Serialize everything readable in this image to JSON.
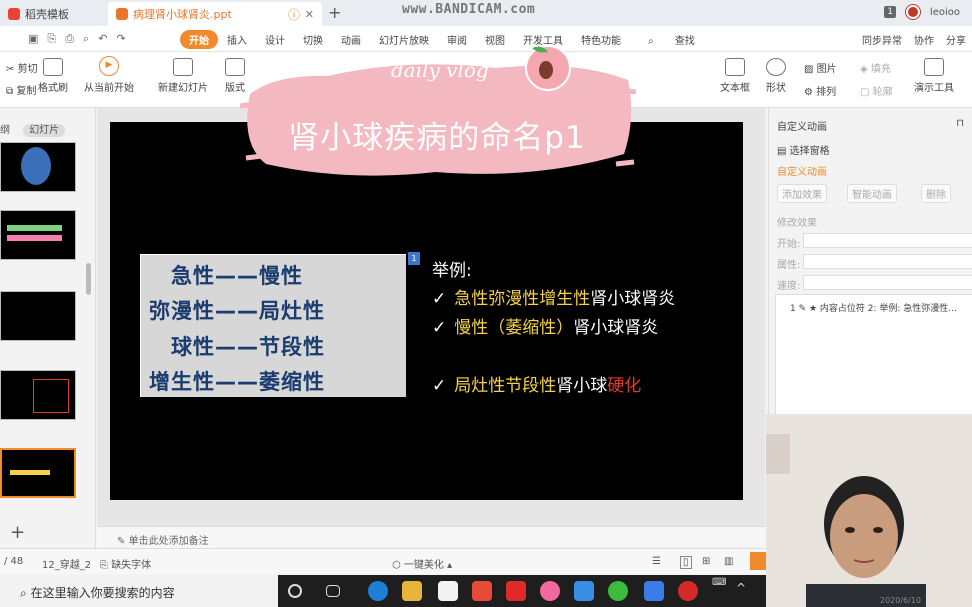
{
  "tabs": {
    "docer": "稻壳模板",
    "ppt": "病理肾小球肾炎.ppt"
  },
  "watermark": "www.BANDICAM.com",
  "user": {
    "badge": "1",
    "name": "leoioo"
  },
  "menu": {
    "items": [
      "开始",
      "插入",
      "设计",
      "切换",
      "动画",
      "幻灯片放映",
      "审阅",
      "视图",
      "开发工具",
      "特色功能"
    ],
    "search": "查找",
    "right": [
      "同步异常",
      "协作",
      "分享"
    ]
  },
  "ribbon": {
    "cut": "剪切",
    "copy": "复制",
    "format_painter": "格式刷",
    "play_from_current": "从当前开始",
    "new_slide": "新建幻灯片",
    "layout": "版式",
    "textbox": "文本框",
    "shape": "形状",
    "picture": "图片",
    "fill": "填充",
    "arrange": "排列",
    "outline": "轮廓",
    "present_tools": "演示工具"
  },
  "banner": {
    "vlog": "daily vlog",
    "title": "肾小球疾病的命名p1"
  },
  "left_panel": {
    "tabs": [
      "纲",
      "幻灯片"
    ],
    "thumb_nums": [
      "1.",
      "1.",
      "1.",
      "1.",
      "1."
    ],
    "add": "+"
  },
  "slide": {
    "terms": [
      "急性——慢性",
      "弥漫性——局灶性",
      "球性——节段性",
      "增生性——萎缩性"
    ],
    "anim_marker": "1",
    "examples_heading": "举例:",
    "examples": [
      {
        "parts": [
          {
            "t": "急性弥漫性增生性",
            "c": "yel"
          },
          {
            "t": "肾小球肾炎",
            "c": "wht"
          }
        ]
      },
      {
        "parts": [
          {
            "t": "慢性（萎缩性）",
            "c": "yel"
          },
          {
            "t": "肾小球肾炎",
            "c": "wht"
          }
        ]
      },
      {
        "parts": [
          {
            "t": "局灶性节段性",
            "c": "yel"
          },
          {
            "t": "肾小球",
            "c": "wht"
          },
          {
            "t": "硬化",
            "c": "red"
          }
        ]
      }
    ],
    "check": "✓"
  },
  "notes": "单击此处添加备注",
  "right_panel": {
    "title": "自定义动画",
    "select_pane": "选择窗格",
    "custom_anim": "自定义动画",
    "add_effect": "添加效果",
    "smart_anim": "智能动画",
    "delete": "删除",
    "modify_effect": "修改效果",
    "start": "开始:",
    "property": "属性:",
    "speed": "速度:",
    "list_item": "1 ✎ ★  内容占位符 2: 举例: 急性弥漫性..."
  },
  "status": {
    "page": "/ 48",
    "theme": "12_穿越_2",
    "missing_font": "缺失字体",
    "beautify": "一键美化"
  },
  "taskbar": {
    "search": "在这里输入你要搜索的内容"
  },
  "date": "2020/6/10",
  "colors": {
    "accent": "#f08a2c",
    "banner_pink": "#f3b8c0",
    "term_blue": "#1a3c6e",
    "example_yellow": "#f5d24a",
    "highlight_red": "#e33a2b"
  }
}
